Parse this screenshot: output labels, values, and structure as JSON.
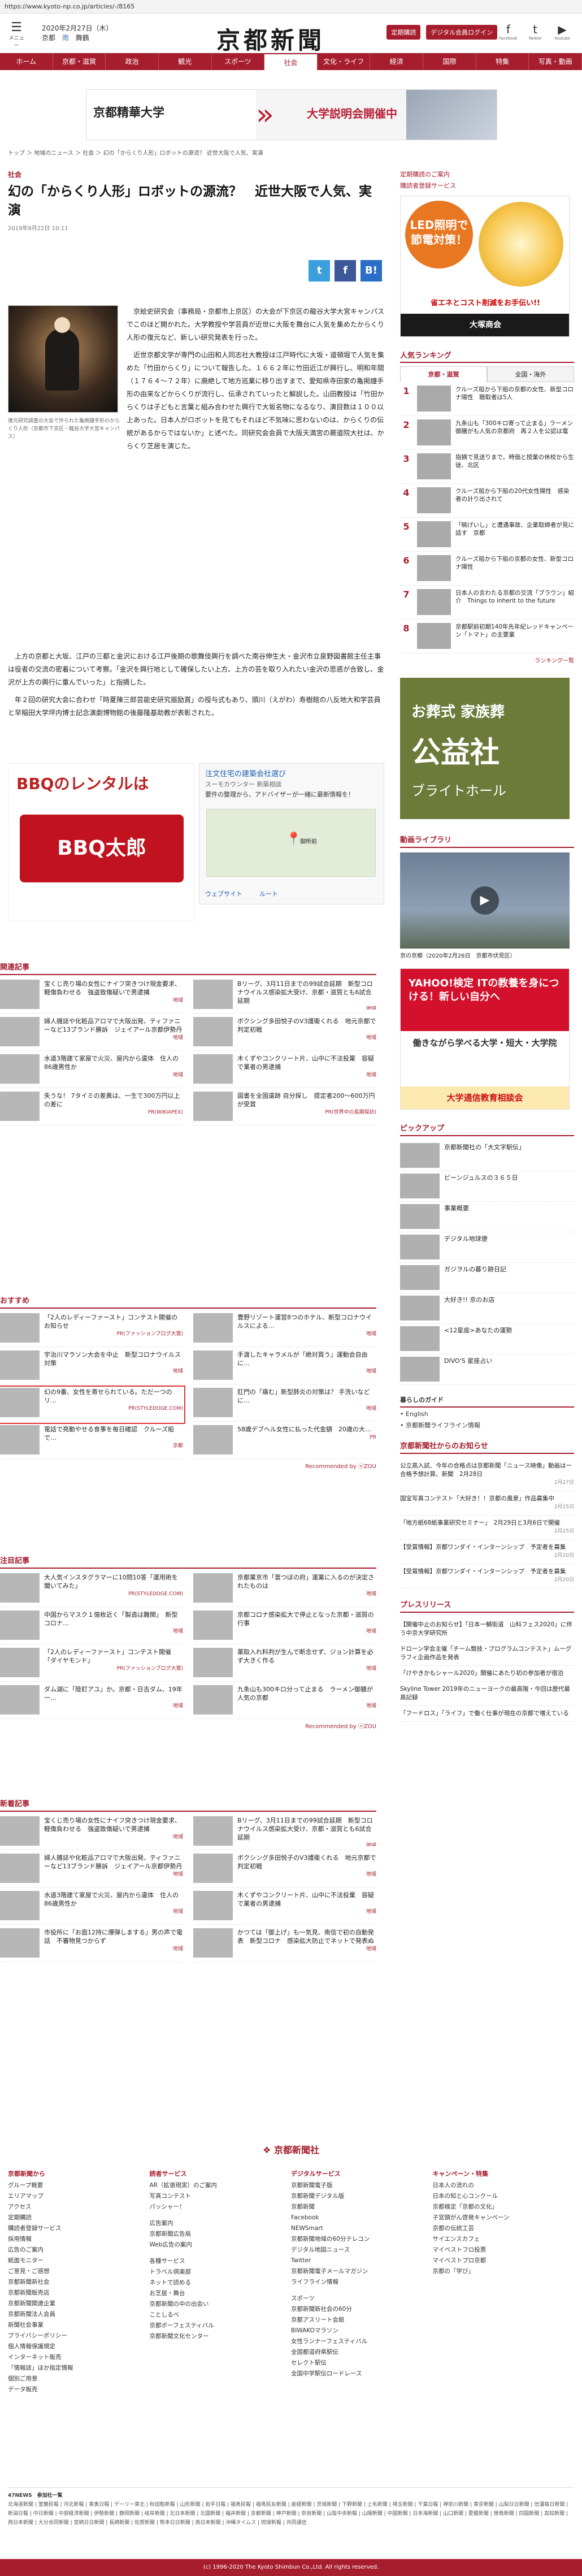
{
  "url": "https://www.kyoto-np.co.jp/articles/-/8165",
  "header": {
    "menu_label": "メニュー",
    "date": "2020年2月27日（木）",
    "weather": [
      {
        "label": "京都",
        "type": "sun"
      },
      {
        "label": "雨",
        "type": "rain"
      },
      {
        "label": "舞鶴",
        "type": "sun"
      }
    ],
    "logo": "京都新聞",
    "btn_subscribe": "定期購読",
    "btn_digital": "デジタル会員ログイン",
    "social": [
      {
        "glyph": "f",
        "label": "Facebook"
      },
      {
        "glyph": "t",
        "label": "Twitter"
      },
      {
        "glyph": "▶",
        "label": "Youtube"
      }
    ]
  },
  "nav": [
    "ホーム",
    "京都・滋賀",
    "政治",
    "観光",
    "スポーツ",
    "社会",
    "文化・ライフ",
    "経済",
    "国際",
    "特集",
    "写真・動画"
  ],
  "banner_top": {
    "left": "京都精華大学",
    "right": "大学説明会開催中"
  },
  "breadcrumb": "トップ ＞ 地域のニュース ＞ 社会 ＞ 幻の「からくり人形」ロボットの源流？ 近世大阪で人気、実演",
  "article": {
    "category": "社会",
    "title": "幻の「からくり人形」ロボットの源流？　近世大阪で人気、実演",
    "date": "2019年8月22日 10:11",
    "share": [
      "t",
      "f",
      "B!"
    ],
    "caption": "復元研究調査の大会で作られた亀掲鐘手形のからくり人形（京都市下京区・龍谷大学大宮キャンパス）",
    "p1": "京絵史研究会（事務局・京都市上京区）の大会が下京区の龍谷大学大宮キャンパスでこのほど開かれた。大学教授や学芸員が近世に大阪を舞台に人気を集めたからくり人形の復元など、新しい研究発表を行った。",
    "p2": "近世京都文学が専門の山田和人同志社大教授は江戸時代に大坂・道頓堀で人気を集めた「竹田からくり」について報告した。１６６２年に竹田近江が興行し、明和年間（１７６４～７２年）に廃絶して地方巡業に移り出すまで、愛知県寺田家の亀掲鐘手形の由来などからくりが流行し、伝承されていったと解説した。山田教授は「竹田からくりは子どもと言葉と組み合わせた興行で大坂名物になるなり、演目数は１００以上あった。日本人がロボットを見てもそれほど不気味に思わないのは、からくりの伝統があるからではないか」と述べた。同研究会会員で大阪天満宮の蕨道院大社は、からくり芝居を演じた。",
    "p3": "上方の京都と大坂、江戸の三都と金沢における江戸後期の歌舞伎興行を調べた南谷伸生大・金沢市立泉野図書館主任主事は役者の交流の密着について考察。「金沢を興行地として確保したい上方、上方の芸を取り入れたい金沢の思惑が合致し、金沢が上方の興行に重んでいった」と指摘した。",
    "p4": "年２回の研究大会に合わせ「時夏陳三郎芸能史研究振励賞」の授与式もあり、頭川（えがわ）寿樹館の八反地大和学芸員と早稲田大学坪内博士記念演劇博物館の後藤隆基助教が表彰された。"
  },
  "ads": {
    "bbq_title": "BBQのレンタルは",
    "bbq_logo": "BBQ太郎",
    "map_title": "注文住宅の建築会社選び",
    "map_sub": "スーモカウンター 新築相談",
    "map_desc": "要件の整理から、アドバイザーが一緒に最新情報を！",
    "map_place": "御所前",
    "map_btn1": "ウェブサイト",
    "map_btn2": "ルート",
    "led_circle": "LED照明で節電対策！",
    "led_mid": "省エネとコスト削減をお手伝い!!",
    "led_foot": "大塚商会",
    "funeral_a": "お葬式 家族葬",
    "funeral_b": "公益社",
    "funeral_c": "ブライトホール",
    "yahoo_top": "YAHOO!検定 ITの教養を身につける！新しい自分へ",
    "yahoo_mid": "働きながら学べる大学・短大・大学院",
    "yahoo_bot": "大学通信教育相談会"
  },
  "sidebar": {
    "links": [
      "定期購読のご案内",
      "購読者登録サービス"
    ],
    "rank_title": "人気ランキング",
    "rank_tabs": [
      "京都・滋賀",
      "全国・海外"
    ],
    "ranking": [
      "クルーズ船から下船の京都の女性、新型コロナ陽性　聴取者は5人",
      "九条山も「300キロ寄って止まる」ラーメン御膳がも人気の京都府　再２人を公認は電",
      "指摘で見送りまで。時価と授業の休校から生徒、北区",
      "クルーズ船から下船の20代女性陽性　感染者の計り出されて",
      "「暁げいし」と遭遇事故、企業取締者が見に話す　京都",
      "クルーズ船から下船の京都の女性、新型コロナ陽性",
      "日本人の言わたる京都の交流「ブラウン」紹介　Things to inherit to the future",
      "京都駅前初期140年先年紀レッドキャンペーン「トマト」の主要業"
    ],
    "rank_more": "ランキング一覧",
    "video_title": "動画ライブラリ",
    "video_cap": "京の京郷（2020年2月26日　京都市伏見区）",
    "pickup_title": "ピックアップ",
    "pickup": [
      "京都新聞社の「大文字駅伝」",
      "ビーンジュルスの３６５日",
      "事業概要",
      "デジタル地球便",
      "ガジヲルの暮り跡日記",
      "大好き!! 京のお店",
      "<12星座>あなたの運勢",
      "DIVO'S 星座占い"
    ],
    "guide_title": "暮らしのガイド",
    "guide": [
      "English",
      "京都新聞ライフライン情報"
    ],
    "notice_title": "京都新聞社からのお知らせ",
    "notices": [
      {
        "t": "公立高入試、今年の合格点は京都新聞「ニュース映像」動画はー合格予想計算。新聞　2月28日",
        "d": "2月27日"
      },
      {
        "t": "国宝写真コンテスト「大好き！！京都の風景」作品募集中",
        "d": "2月25日"
      },
      {
        "t": "「地方紙68紙事業研究セミナー」　2月29日と3月6日で開催",
        "d": "2月25日"
      },
      {
        "t": "【受賞情報】京都ワンダイ・インターンシップ　予定者を募集",
        "d": "2月20日"
      },
      {
        "t": "【受賞情報】京都ワンダイ・インターンシップ　予定者を募集",
        "d": "2月20日"
      }
    ],
    "press_title": "プレスリリース",
    "press": [
      "【開催中止のお知らせ】「日本一鯖街道　山科フェス2020」に伴う中京大学研究所",
      "ドローン学会主催「チーム競技・プログラムコンテスト」ムーグラフィ企画作品を発表",
      "「けやきかもシャール2020」開催にあたり初の参加者が宿泊",
      "Skyline Tower 2019年のニューヨークの最高階・今回は歴代最高記録",
      "「フードロス」「ライフ」で働く仕事が現在の京都で増えている"
    ]
  },
  "related_title": "関連記事",
  "related": [
    {
      "t": "宝くじ売り場の女性にナイフ突きつけ現金要求、軽傷負わせる　強盗致傷疑いで男逮捕",
      "s": "地域"
    },
    {
      "t": "Bリーグ、3月11日までの99試合延期　新型コロナウイルス感染拡大受け、京都・滋賀とも6試合延期",
      "s": "地域"
    },
    {
      "t": "婦人雑誌や化粧品アロマで大阪出発、ティファニーなど13ブランド勝訴　ジェイアール京都伊勢丹",
      "s": "地域"
    },
    {
      "t": "ボクシング多田悦子のV3護衛くれる　地元京都で判定初戦",
      "s": "地域"
    },
    {
      "t": "水道3階建て家屋で火災、屋内から遺体　住人の86歳男性か",
      "s": "地域"
    },
    {
      "t": "木くずやコンクリート片、山中に不法投棄　容疑で業者の男逮捕",
      "s": "地域"
    },
    {
      "t": "失うな！ 7タイミの差異は、一生で300万円以上の差に",
      "s": "PR(WIKIAPEX)"
    },
    {
      "t": "図書を全国遺跡 自分探し　提定者200～600万円が受賞",
      "s": "PR(世界中の長期探訪)"
    }
  ],
  "osusume_title": "おすすめ",
  "osusume": [
    {
      "t": "「2人のレディーファースト」コンテスト開催のお知らせ",
      "s": "PR(ファッションブログ大賞)"
    },
    {
      "t": "豊野リゾート運営8つのホテル、新型コロナウイルスによる…",
      "s": "地域"
    },
    {
      "t": "宇治川マラソン大会を中止　新型コロナウイルス対策",
      "s": "地域"
    },
    {
      "t": "手渡したキャラメルが「絶対買う」運動会自由に…",
      "s": "地域"
    },
    {
      "t": "幻の9番、女性を寄せられている。ただ一つのリ…",
      "s": "PR(STYLEDOGE.COM)",
      "hl": true
    },
    {
      "t": "肛門の「痛む」新型肺炎の対策は？ 手洗いなどに…",
      "s": "地域"
    },
    {
      "t": "電話で亮動やせる食事を毎日確認　クルーズ船で…",
      "s": "京都"
    },
    {
      "t": "58歳デブヘル女性に払った代金額　20歳の大…",
      "s": "PR"
    }
  ],
  "osusume_footer": "Recommended by ⓤZOU",
  "chumoku_title": "注目記事",
  "chumoku": [
    {
      "t": "大人気インスタグラマーに10問10答「運用術を聞いてみた」",
      "s": "PR(STYLEDOGE.COM)"
    },
    {
      "t": "京都業京市「雲つぼの府」運業に入るのが決定されたものは",
      "s": "地域"
    },
    {
      "t": "中国からマスク１億枚近く「製造は難関」　新型コロナ…",
      "s": "地域"
    },
    {
      "t": "京都コロナ感染拡大で停止となった京都・滋賀の行事",
      "s": "地域"
    },
    {
      "t": "「2人のレディーファースト」コンテスト開催「ダイヤモンド」",
      "s": "PR(ファッションブログ大賞)"
    },
    {
      "t": "薬取入れ料判が生んで断念せず、ジョン計算を必ず大きく作る",
      "s": "地域"
    },
    {
      "t": "ダム湖に「陸釘アユ」か。京都・日吉ダム、19年一…",
      "s": "地域"
    },
    {
      "t": "九条山も300キロ分って止まる　ラーメン御膳が人気の京都",
      "s": "地域"
    }
  ],
  "chumoku_footer": "Recommended by ⓤZOU",
  "shinchaku_title": "新着記事",
  "shinchaku": [
    {
      "t": "宝くじ売り場の女性にナイフ突きつけ現金要求、軽傷負わせる　強盗致傷疑いで男逮捕",
      "s": "地域"
    },
    {
      "t": "Bリーグ、3月11日までの99試合延期　新型コロナウイルス感染拡大受け、京都・滋賀とも6試合延期",
      "s": "地域"
    },
    {
      "t": "婦人雑誌や化粧品アロマで大阪出発、ティファニーなど13ブランド勝訴　ジェイアール京都伊勢丹",
      "s": "地域"
    },
    {
      "t": "ボクシング多田悦子のV3護衛くれる　地元京都で判定初戦",
      "s": "地域"
    },
    {
      "t": "水道3階建て家屋で火災、屋内から遺体　住人の86歳男性か",
      "s": "地域"
    },
    {
      "t": "木くずやコンクリート片、山中に不法投棄　容疑で業者の男逮捕",
      "s": "地域"
    },
    {
      "t": "市役所に「お面12持に爆弾しまする」男の声で電話　不審物見つからず",
      "s": "地域"
    },
    {
      "t": "かつては「御上げ」も一気見、南信で初の自動発表　新型コロナ　感染拡大防止でネットで発表ぬ",
      "s": "地域"
    }
  ],
  "footer": {
    "logo": "京都新聞社",
    "cols": [
      {
        "h": "京都新聞から",
        "items": [
          "グループ概要",
          "エリアマップ",
          "アクセス",
          "定期購読",
          "購読者登録サービス",
          "採用情報",
          "広告のご案内",
          "紙面モニター",
          "ご意見・ご感想",
          "京都新聞新社会",
          "京都新聞販売店",
          "京都新聞関連企業",
          "京都新聞法人会員",
          "新聞社会事業",
          "プライバシーポリシー",
          "個人情報保護規定",
          "インターネット販売",
          "「情報誌」ほか指定情報",
          "個別ご用意",
          "データ販売"
        ]
      },
      {
        "h": "読者サービス",
        "items": [
          "AR（拡張現実）のご案内",
          "写真コンテスト",
          "パッシャー！",
          "",
          "広告案内",
          "京都新聞広告局",
          "Web広告の案内",
          "",
          "各種サービス",
          "トラベル倶楽部",
          "ネットで読める",
          "お芝居・舞台",
          "京都新聞の中の出会い",
          "ことしるべ",
          "京都ボーフェスティバル",
          "京都新聞文化センター"
        ]
      },
      {
        "h": "デジタルサービス",
        "items": [
          "京都新聞電子版",
          "京都新聞デジタル版",
          "京都新聞",
          "Facebook",
          "NEWSmart",
          "京都新聞地域の60分テレコン",
          "デジタル地図ニュース",
          "Twitter",
          "京都新聞電子メールマガジン",
          "ライフライン情報",
          "",
          "スポーツ",
          "京都新聞新社会の60分",
          "京都アスリート会館",
          "BIWAKOマラソン",
          "女性ランナーフェスティバル",
          "全国都道府県駅伝",
          "セレクト駅伝",
          "全国中学駅伝ロードレース"
        ]
      },
      {
        "h": "キャンペーン・特集",
        "items": [
          "日本人の流れの",
          "日本の知と心コンクール",
          "京都検定「京都の文化」",
          "子宮頸がん啓発キャンペーン",
          "京都の伝統工芸",
          "サイエンスカフェ",
          "マイベストフロ投票",
          "マイベストプロ京都",
          "京都の「学び」"
        ]
      }
    ],
    "news_title": "47NEWS　参加社一覧",
    "news_list": "北海道新聞 | 室蘭民報 | 河北新報 | 東奥日報 | デーリー東北 | 秋田魁新報 | 山形新聞 | 岩手日報 | 福島民報 | 福島民友新聞 | 産経新聞 | 茨城新聞 | 下野新聞 | 上毛新聞 | 埼玉新聞 | 千葉日報 | 神奈川新聞 | 東京新聞 | 山梨日日新聞 | 信濃毎日新聞 | 新潟日報 | 中日新聞 | 中部経済新聞 | 伊勢新聞 | 静岡新聞 | 岐阜新聞 | 北日本新聞 | 北國新聞 | 福井新聞 | 京都新聞 | 神戸新聞 | 奈良新聞 | 山陰中央新報 | 山陽新聞 | 中国新聞 | 日本海新聞 | 山口新聞 | 愛媛新聞 | 徳島新聞 | 四国新聞 | 高知新聞 | 西日本新聞 | 大分合同新聞 | 宮崎日日新聞 | 長崎新聞 | 佐賀新聞 | 熊本日日新聞 | 南日本新聞 | 沖縄タイムス | 琉球新報 | 共同通信",
    "copyright": "(c) 1996-2020 The Kyoto Shimbun Co.,Ltd. All rights reserved."
  },
  "colors": {
    "brand": "#a61e2e",
    "accent_blue": "#3c9fdd"
  }
}
